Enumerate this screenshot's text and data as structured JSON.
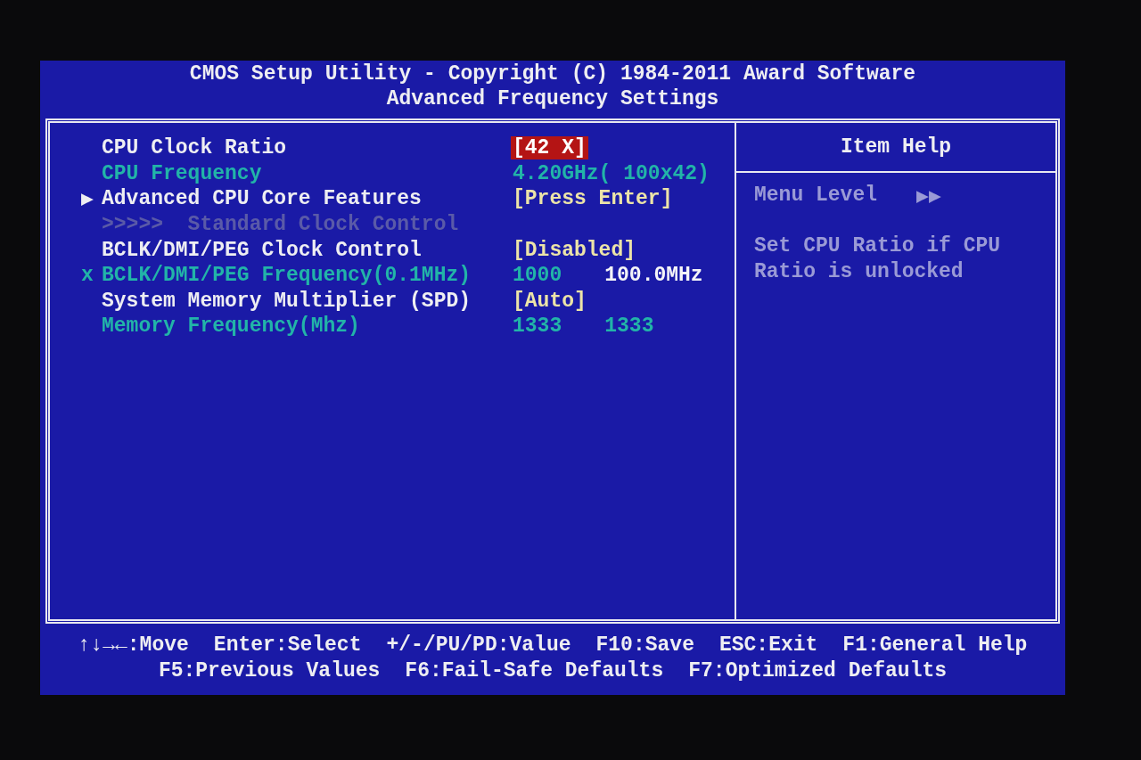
{
  "header": {
    "title": "CMOS Setup Utility - Copyright (C) 1984-2011 Award Software",
    "subtitle": "Advanced Frequency Settings"
  },
  "settings": [
    {
      "kind": "setting",
      "label": "CPU Clock Ratio",
      "values": [
        {
          "text": "[42 X]",
          "kind": "option"
        }
      ],
      "selected": true
    },
    {
      "kind": "info",
      "label": "CPU Frequency",
      "values": [
        {
          "text": "4.20GHz( 100x42)",
          "kind": "info"
        }
      ],
      "selected": false
    },
    {
      "kind": "setting",
      "marker": "▶",
      "label": "Advanced CPU Core Features",
      "values": [
        {
          "text": "[Press Enter]",
          "kind": "option"
        }
      ],
      "selected": false
    },
    {
      "kind": "disabled",
      "label": ">>>>>  Standard Clock Control",
      "selected": false
    },
    {
      "kind": "setting",
      "label": "BCLK/DMI/PEG Clock Control",
      "values": [
        {
          "text": "[Disabled]",
          "kind": "option"
        }
      ],
      "selected": false
    },
    {
      "kind": "info",
      "marker": "x",
      "label": "BCLK/DMI/PEG Frequency(0.1MHz)",
      "values": [
        {
          "text": "1000",
          "kind": "info"
        },
        {
          "text": "100.0MHz",
          "kind": "readout"
        }
      ],
      "selected": false
    },
    {
      "kind": "setting",
      "label": "System Memory Multiplier (SPD)",
      "values": [
        {
          "text": "[Auto]",
          "kind": "option"
        }
      ],
      "selected": false
    },
    {
      "kind": "info",
      "label": "Memory Frequency(Mhz)",
      "values": [
        {
          "text": "1333",
          "kind": "info"
        },
        {
          "text": "1333",
          "kind": "info"
        }
      ],
      "selected": false
    }
  ],
  "help": {
    "title": "Item Help",
    "menu_level_label": "Menu Level",
    "menu_level_arrows": "▶▶",
    "text": "Set CPU Ratio if CPU Ratio is unlocked"
  },
  "footer": [
    [
      "↑↓→←:Move",
      "Enter:Select",
      "+/-/PU/PD:Value",
      "F10:Save",
      "ESC:Exit",
      "F1:General Help"
    ],
    [
      "F5:Previous Values",
      "F6:Fail-Safe Defaults",
      "F7:Optimized Defaults"
    ]
  ]
}
